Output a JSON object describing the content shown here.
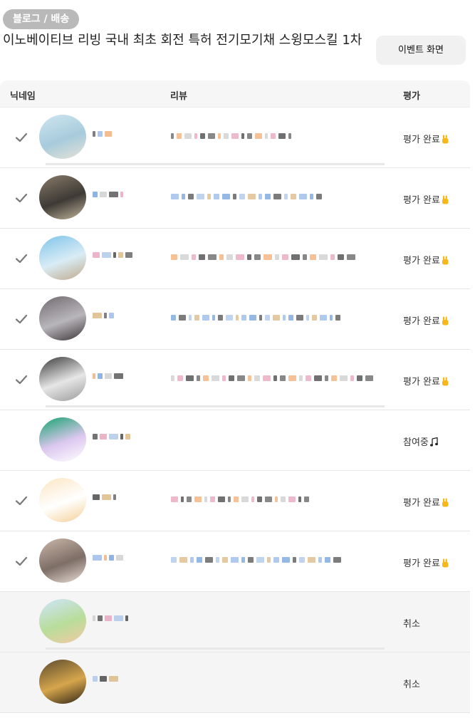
{
  "header": {
    "badge": "블로그 / 배송",
    "title": "이노베이티브 리빙 국내 최초 회전 특허 전기모기채 스윙모스킬 1차",
    "event_button": "이벤트 화면"
  },
  "table": {
    "columns": {
      "nickname": "닉네임",
      "review": "리뷰",
      "rating": "평가"
    },
    "rows": [
      {
        "checked": true,
        "status": "평가 완료",
        "status_icon": "victory-hand-icon",
        "avatar": [
          "#cfe6f0",
          "#a7cbdc",
          "#e7e2d7"
        ]
      },
      {
        "checked": true,
        "status": "평가 완료",
        "status_icon": "victory-hand-icon",
        "avatar": [
          "#8a7b6a",
          "#3d3a35",
          "#c3b59c"
        ]
      },
      {
        "checked": true,
        "status": "평가 완료",
        "status_icon": "victory-hand-icon",
        "avatar": [
          "#7ec3ea",
          "#d9ecf5",
          "#bfa98a"
        ]
      },
      {
        "checked": true,
        "status": "평가 완료",
        "status_icon": "victory-hand-icon",
        "avatar": [
          "#6f6a6e",
          "#b9b6bb",
          "#3a3538"
        ]
      },
      {
        "checked": true,
        "status": "평가 완료",
        "status_icon": "victory-hand-icon",
        "avatar": [
          "#3b3b3b",
          "#e6e6e6",
          "#9a9a9a"
        ]
      },
      {
        "checked": false,
        "status": "참여중",
        "status_icon": "music-notes-icon",
        "avatar": [
          "#14a36e",
          "#dcc7ef",
          "#ffffff"
        ]
      },
      {
        "checked": true,
        "status": "평가 완료",
        "status_icon": "victory-hand-icon",
        "avatar": [
          "#fbe6c3",
          "#ffffff",
          "#f5cf96"
        ]
      },
      {
        "checked": true,
        "status": "평가 완료",
        "status_icon": "victory-hand-icon",
        "avatar": [
          "#cbb7aa",
          "#7d6e66",
          "#e9ddd7"
        ]
      },
      {
        "checked": false,
        "status": "취소",
        "status_icon": "",
        "avatar": [
          "#cfe4fb",
          "#b8dd9a",
          "#f4c9a4"
        ]
      },
      {
        "checked": false,
        "status": "취소",
        "status_icon": "",
        "avatar": [
          "#5c4a2e",
          "#d6a64c",
          "#2f2416"
        ]
      }
    ]
  },
  "colors": {
    "badge_bg": "#b9b9b9",
    "row_cancel_bg": "#f5f5f5",
    "check": "#7a7a7a"
  }
}
